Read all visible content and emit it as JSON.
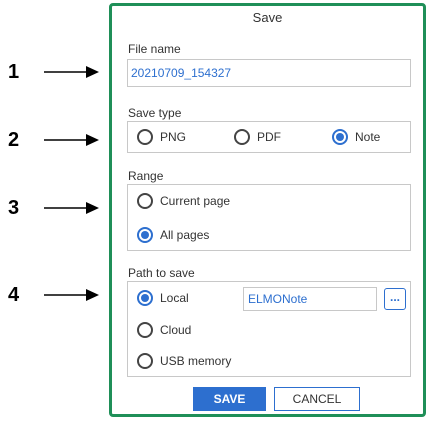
{
  "callouts": [
    "1",
    "2",
    "3",
    "4"
  ],
  "dialog": {
    "title": "Save",
    "file_name": {
      "label": "File name",
      "value": "20210709_154327"
    },
    "save_type": {
      "label": "Save type",
      "options": [
        "PNG",
        "PDF",
        "Note"
      ],
      "selected": "Note"
    },
    "range": {
      "label": "Range",
      "options": [
        "Current page",
        "All pages"
      ],
      "selected": "All pages"
    },
    "path": {
      "label": "Path to save",
      "options": [
        "Local",
        "Cloud",
        "USB memory"
      ],
      "selected": "Local",
      "folder": "ELMONote",
      "browse_label": "..."
    },
    "buttons": {
      "save": "SAVE",
      "cancel": "CANCEL"
    }
  },
  "colors": {
    "accent": "#2d6fcf",
    "border": "#1f8f58"
  }
}
